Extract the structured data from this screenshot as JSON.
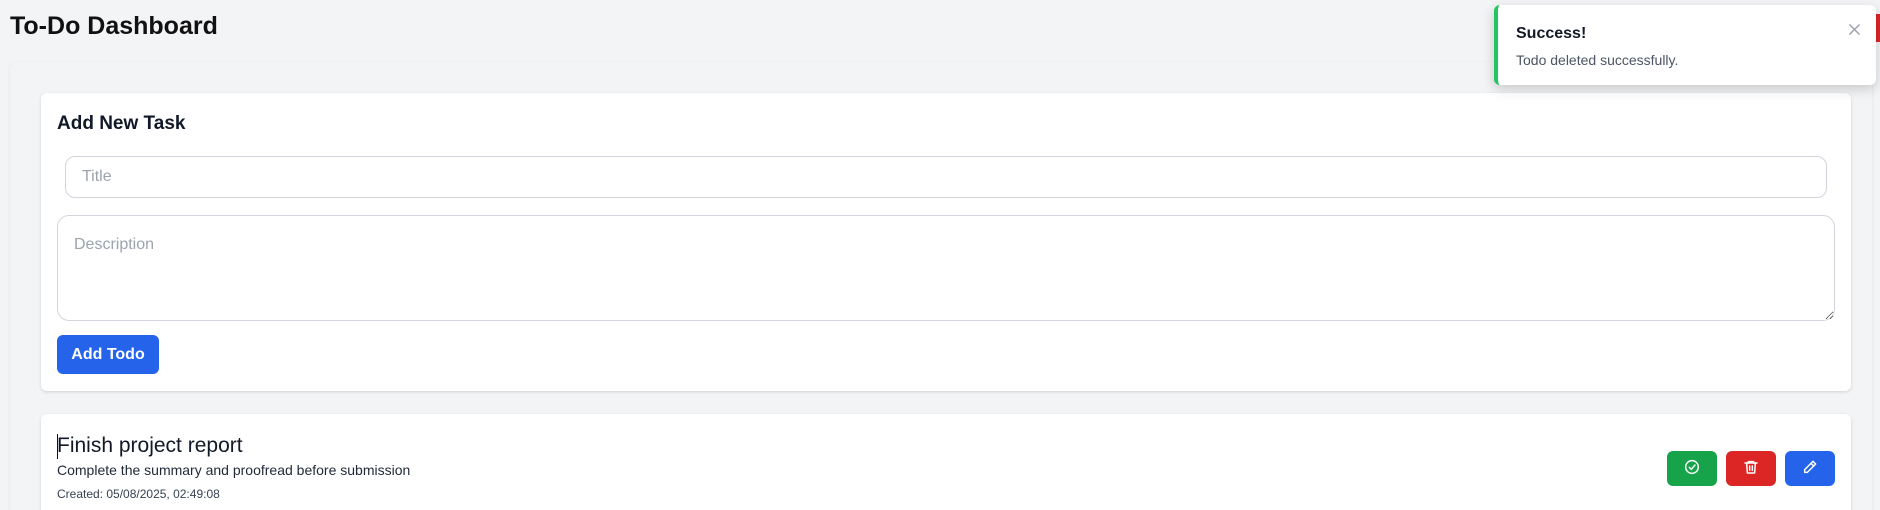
{
  "header": {
    "title": "To-Do Dashboard"
  },
  "add_task": {
    "heading": "Add New Task",
    "title_placeholder": "Title",
    "title_value": "",
    "description_placeholder": "Description",
    "description_value": "",
    "submit_label": "Add Todo"
  },
  "todos": [
    {
      "title": "Finish project report",
      "description": "Complete the summary and proofread before submission",
      "created": "Created: 05/08/2025, 02:49:08",
      "actions": [
        {
          "name": "complete",
          "icon": "check-circle-icon"
        },
        {
          "name": "delete",
          "icon": "trash-icon"
        },
        {
          "name": "edit",
          "icon": "pencil-icon"
        }
      ]
    }
  ],
  "toast": {
    "title": "Success!",
    "message": "Todo deleted successfully.",
    "close_icon": "close-icon"
  },
  "colors": {
    "primary": "#2563eb",
    "success": "#16a34a",
    "danger": "#dc2626",
    "toast_accent": "#22c55e",
    "background": "#f3f4f6"
  }
}
